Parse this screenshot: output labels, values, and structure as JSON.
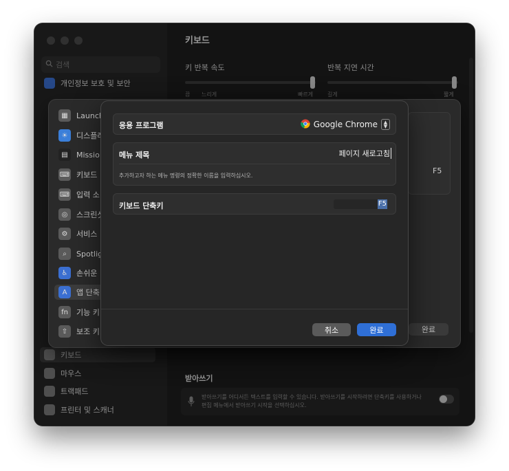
{
  "sidebar": {
    "search_placeholder": "검색",
    "items_top": [
      {
        "label": "개인정보 보호 및 보안"
      }
    ],
    "items_bottom": [
      {
        "label": "키보드"
      },
      {
        "label": "마우스"
      },
      {
        "label": "트랙패드"
      },
      {
        "label": "프린터 및 스캐너"
      }
    ]
  },
  "main": {
    "title": "키보드",
    "key_repeat_label": "키 반복 속도",
    "key_repeat_left": "끔",
    "key_repeat_left2": "느리게",
    "key_repeat_right": "빠르게",
    "delay_label": "반복 지연 시간",
    "delay_left": "길게",
    "delay_right": "짧게",
    "dictation_title": "받아쓰기",
    "dictation_desc_1": "받아쓰기를 어디서든 텍스트를 입력할 수 있습니다. 받아쓰기를 시작하려면 단축키를 사용하거나",
    "dictation_desc_2": "편집 메뉴에서 받아쓰기 시작을 선택하십시오."
  },
  "behind_dialog": {
    "items": [
      {
        "label": "Launchp"
      },
      {
        "label": "디스플레"
      },
      {
        "label": "Missio"
      },
      {
        "label": "키보드"
      },
      {
        "label": "입력 소"
      },
      {
        "label": "스크린샷"
      },
      {
        "label": "서비스"
      },
      {
        "label": "Spotlig"
      },
      {
        "label": "손쉬운"
      },
      {
        "label": "앱 단축"
      },
      {
        "label": "기능 키"
      },
      {
        "label": "보조 키"
      }
    ],
    "f5_text": "F5",
    "done_label": "완료"
  },
  "dialog": {
    "app_label": "응용 프로그램",
    "app_value": "Google Chrome",
    "menu_title_label": "메뉴 제목",
    "menu_title_value": "페이지 새로고침",
    "menu_hint": "추가하고자 하는 메뉴 명령의 정확한 이름을 입력하십시오.",
    "shortcut_label": "키보드 단축키",
    "shortcut_value": "F5",
    "cancel_label": "취소",
    "done_label": "완료"
  },
  "colors": {
    "accent": "#2f6fd6",
    "cancel_bg": "#5a5a5a"
  }
}
